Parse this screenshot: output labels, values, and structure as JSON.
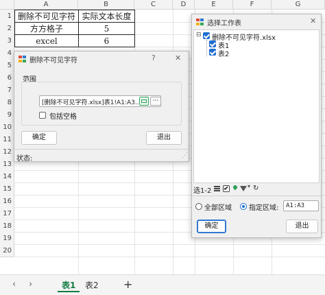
{
  "sheet": {
    "columns": [
      "A",
      "B",
      "C",
      "D",
      "E",
      "F",
      "G"
    ],
    "rows": [
      "1",
      "2",
      "3",
      "4",
      "5",
      "6",
      "7",
      "8",
      "9",
      "10",
      "11",
      "12",
      "13",
      "14",
      "15",
      "16",
      "17",
      "18",
      "19",
      "20"
    ],
    "table": {
      "header": [
        "删除不可见字符",
        "实际文本长度"
      ],
      "rows": [
        [
          "方方格子",
          "5"
        ],
        [
          "excel",
          "6"
        ]
      ]
    }
  },
  "tabs": {
    "prev": "‹",
    "next": "›",
    "items": [
      "表1",
      "表2"
    ],
    "active": "表1",
    "add": "+"
  },
  "dialog_remove": {
    "title": "删除不可见字符",
    "help": "?",
    "close": "✕",
    "group_label": "范围",
    "range_value": "[删除不可见字符.xlsx]表1!A1:A3...",
    "more": "···",
    "include_spaces_label": "包括空格",
    "include_spaces_checked": false,
    "ok": "确定",
    "exit": "退出",
    "status_label": "状态:"
  },
  "dialog_select": {
    "title": "选择工作表",
    "close": "✕",
    "tree": {
      "toggle": "⊟",
      "root": "删除不可见字符.xlsx",
      "children": [
        "表1",
        "表2"
      ]
    },
    "toolbar": {
      "selection_count": "选1-2",
      "refresh": "↻"
    },
    "scope_all_label": "全部区域",
    "scope_custom_label": "指定区域:",
    "scope_custom_value": "A1:A3",
    "scope_selected": "custom",
    "ok": "确定",
    "exit": "退出"
  }
}
